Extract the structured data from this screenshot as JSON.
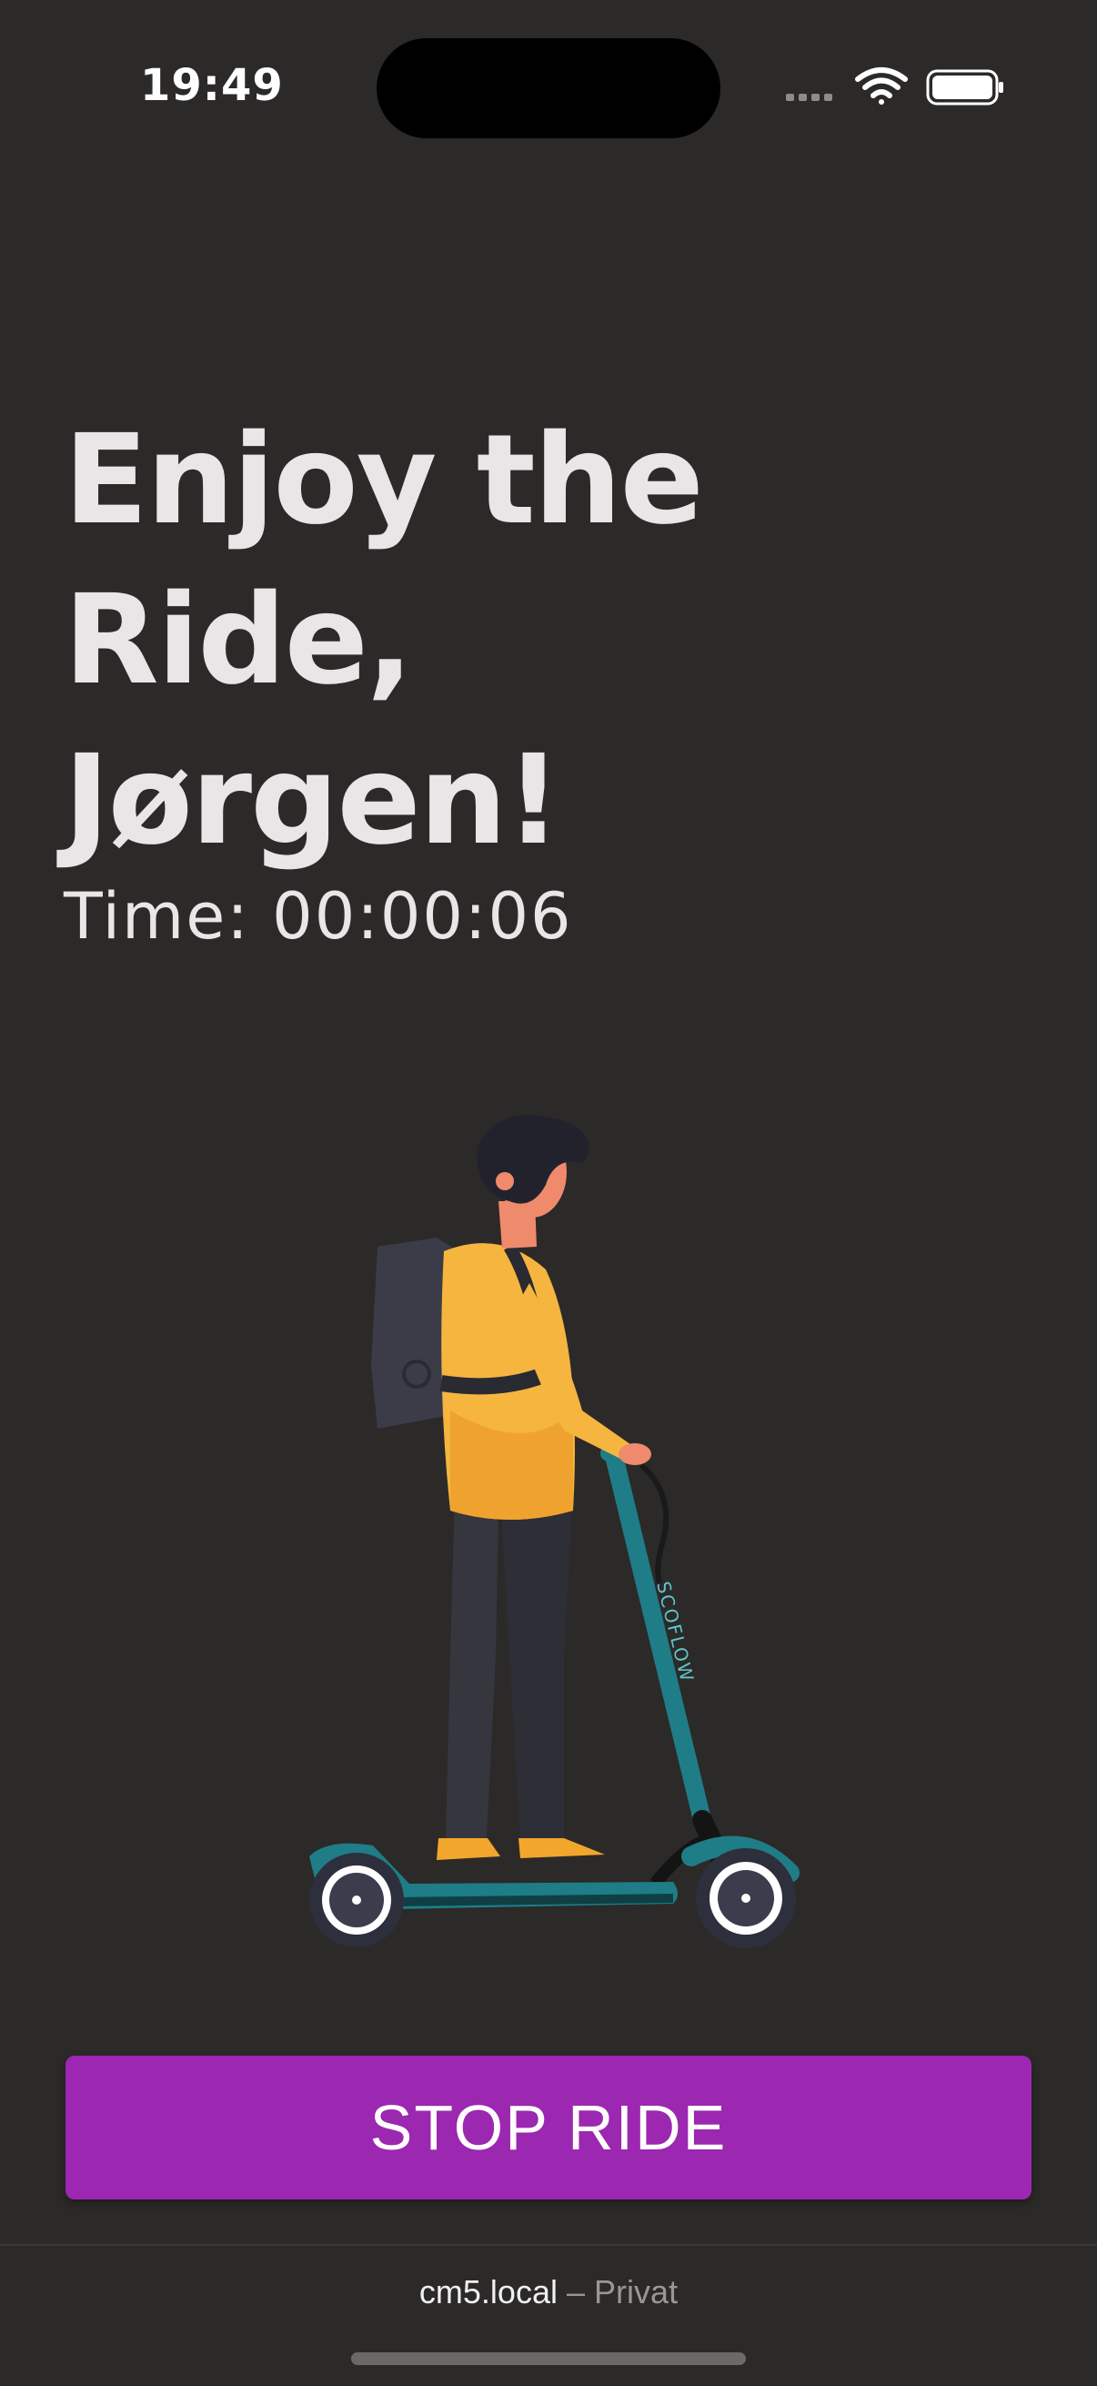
{
  "status_bar": {
    "time": "19:49"
  },
  "ride": {
    "headline_line1": "Enjoy the Ride,",
    "headline_line2": "Jørgen!",
    "timer_label": "Time:",
    "timer_value": "00:00:06"
  },
  "actions": {
    "stop_label": "STOP RIDE"
  },
  "browser": {
    "host": "cm5.local",
    "separator": "–",
    "mode": "Privat"
  },
  "illustration": {
    "scooter_brand": "SCOFLOW"
  },
  "colors": {
    "background": "#2c2929",
    "accent": "#9c27b0",
    "text": "#e8e6e6"
  }
}
